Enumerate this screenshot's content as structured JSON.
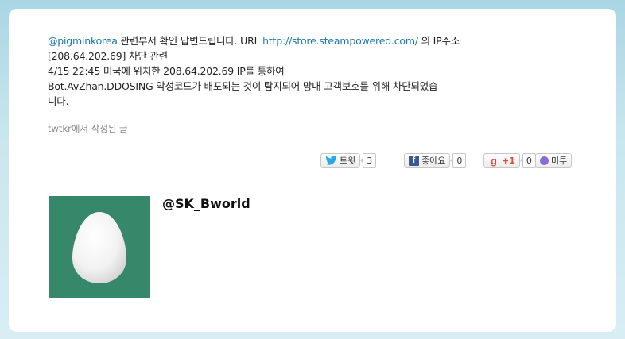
{
  "tweet": {
    "mention": "@pigminkorea",
    "text_after_mention": " 관련부서 확인 답변드립니다. URL ",
    "url": "http://store.steampowered.com/",
    "text_after_url": " 의 IP주소",
    "line2": "[208.64.202.69] 차단 관련",
    "line3": "4/15 22:45 미국에 위치한 208.64.202.69 IP를 통하여",
    "line4": "Bot.AvZhan.DDOSING 악성코드가 배포되는 것이 탐지되어 망내 고객보호를 위해 차단되었습",
    "line5": "니다."
  },
  "source": {
    "app_link": "twtkr",
    "suffix": "에서 작성된 글"
  },
  "share": {
    "tweet_label": "트윗",
    "tweet_count": "3",
    "like_label": "좋아요",
    "like_count": "0",
    "gplus_label": "+1",
    "gplus_count": "0",
    "me2day_label": "미투"
  },
  "profile": {
    "handle": "@SK_Bworld"
  },
  "colors": {
    "link": "#1a7ab0",
    "avatar_bg": "#37876a",
    "facebook": "#3b5998",
    "gplus": "#dd4b39"
  },
  "icons": [
    "twitter-bird-icon",
    "facebook-icon",
    "google-plus-icon",
    "me2day-icon",
    "default-egg-avatar"
  ]
}
